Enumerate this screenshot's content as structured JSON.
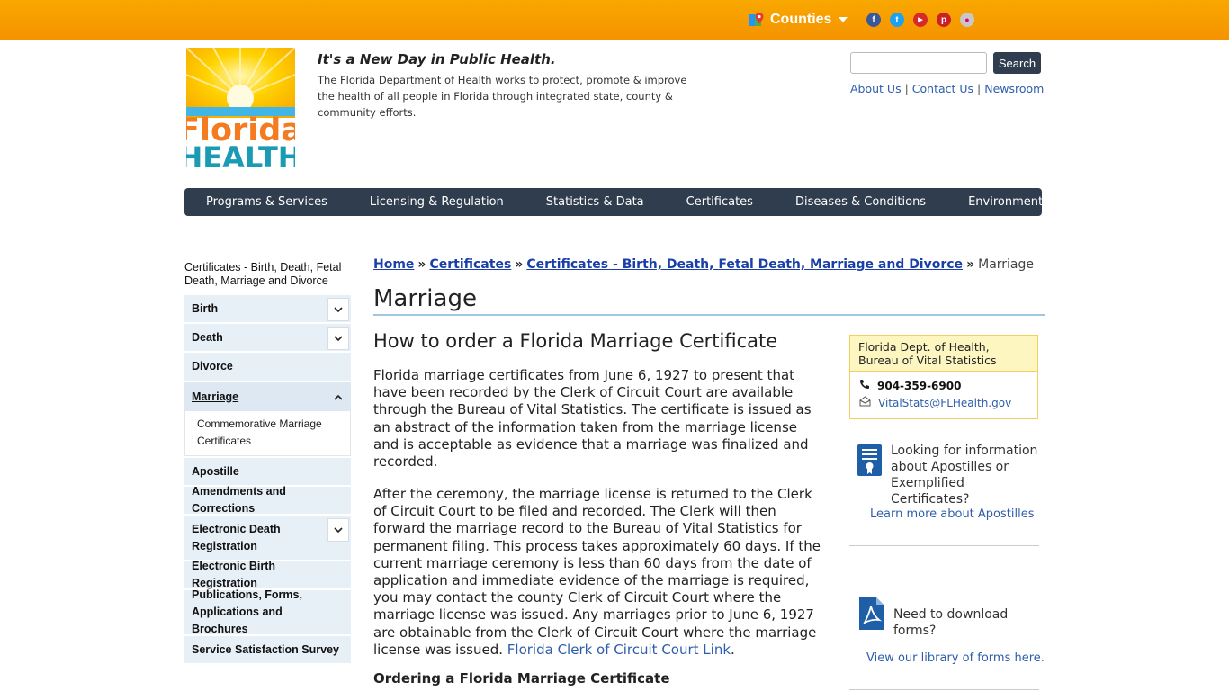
{
  "topbar": {
    "counties_label": "Counties",
    "social": [
      {
        "icon": "facebook-icon",
        "glyph": "f",
        "color": "#3b5998"
      },
      {
        "icon": "twitter-icon",
        "glyph": "t",
        "color": "#1da1f2"
      },
      {
        "icon": "youtube-icon",
        "glyph": "▶",
        "color": "#d62a2a"
      },
      {
        "icon": "pinterest-icon",
        "glyph": "p",
        "color": "#cb2027"
      },
      {
        "icon": "flickr-icon",
        "glyph": "●",
        "color": "#c8c8c8"
      }
    ]
  },
  "header": {
    "logo_top": "Florida",
    "logo_bottom": "HEALTH",
    "tagline": "It's a New Day in Public Health.",
    "mission": "The Florida Department of Health works to protect, promote & improve the health of all people in Florida through integrated state, county & community efforts.",
    "search_button": "Search",
    "links": [
      "About Us",
      "Contact Us",
      "Newsroom"
    ]
  },
  "mainnav": [
    "Programs & Services",
    "Licensing & Regulation",
    "Statistics & Data",
    "Certificates",
    "Diseases & Conditions",
    "Environmental Health"
  ],
  "sidebar": {
    "title": "Certificates - Birth, Death, Fetal Death, Marriage and Divorce",
    "items": [
      {
        "label": "Birth",
        "toggle": "down"
      },
      {
        "label": "Death",
        "toggle": "down"
      },
      {
        "label": "Divorce"
      },
      {
        "label": "Marriage",
        "toggle": "up",
        "active": true
      },
      {
        "label": "Apostille"
      },
      {
        "label": "Amendments and Corrections"
      },
      {
        "label": "Electronic Death Registration",
        "toggle": "down"
      },
      {
        "label": "Electronic Birth Registration"
      },
      {
        "label": "Publications, Forms, Applications and Brochures"
      },
      {
        "label": "Service Satisfaction Survey"
      }
    ],
    "subitem": "Commemorative Marriage Certificates"
  },
  "breadcrumb": {
    "home": "Home",
    "certificates": "Certificates",
    "section": "Certificates - Birth, Death, Fetal Death, Marriage and Divorce",
    "current": "Marriage",
    "sep": "»"
  },
  "main": {
    "title": "Marriage",
    "subtitle": "How to order a Florida Marriage Certificate",
    "para1": "Florida marriage certificates from June 6, 1927 to present that have been recorded by the Clerk of Circuit Court are available through the Bureau of Vital Statistics. The certificate is issued as an abstract of the information taken from the marriage license and is acceptable as evidence that a marriage was finalized and recorded.",
    "para2": "After the ceremony, the marriage license is returned to the Clerk of Circuit Court to be filed and recorded. The Clerk will then forward the marriage record to the Bureau of Vital Statistics for permanent filing. This process takes approximately 60 days. If the current marriage ceremony is less than 60 days from the date of application and immediate evidence of the marriage is required, you may contact the county Clerk of Circuit Court where the marriage license was issued. Any marriages prior to June 6, 1927 are obtainable from the Clerk of Circuit Court where the marriage license was issued.",
    "para2_link": "Florida Clerk of Circuit Court Link",
    "para2_end": ".",
    "h3": "Ordering a Florida Marriage Certificate"
  },
  "contact": {
    "name": "Florida Dept. of Health, Bureau of Vital Statistics",
    "phone": "904-359-6900",
    "email": "VitalStats@FLHealth.gov"
  },
  "promo1": {
    "text": "Looking for information about Apostilles or Exemplified Certificates?",
    "link": "Learn more about Apostilles"
  },
  "promo2": {
    "text": "Need to download forms?",
    "link": "View our library of forms here."
  },
  "colors": {
    "topbar": "#f59e00",
    "nav": "#2f3d4e",
    "link": "#2e5eaa",
    "sidenav_bg": "#e8f0f7",
    "contact_bg": "#fdf6c0"
  }
}
